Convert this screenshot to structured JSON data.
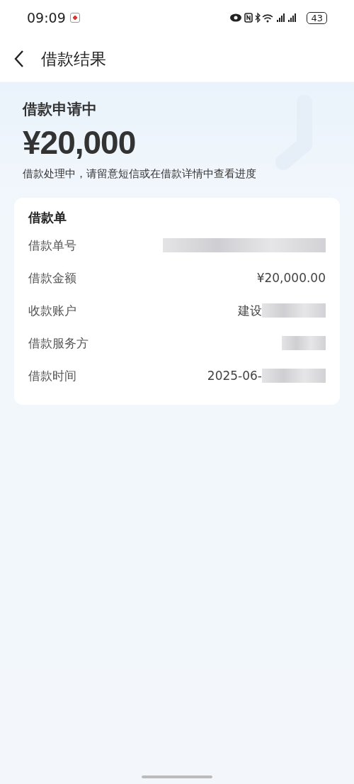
{
  "status_bar": {
    "time": "09:09",
    "battery": "43"
  },
  "header": {
    "title": "借款结果"
  },
  "summary": {
    "status": "借款申请中",
    "amount": "¥20,000",
    "note": "借款处理中，请留意短信或在借款详情中查看进度"
  },
  "card": {
    "title": "借款单",
    "rows": [
      {
        "label": "借款单号",
        "redacted": true
      },
      {
        "label": "借款金额",
        "value": "¥20,000.00",
        "redacted": false
      },
      {
        "label": "收款账户",
        "value": "建设",
        "redacted": true
      },
      {
        "label": "借款服务方",
        "redacted": true
      },
      {
        "label": "借款时间",
        "value": "2025-06-",
        "redacted": true
      }
    ]
  }
}
